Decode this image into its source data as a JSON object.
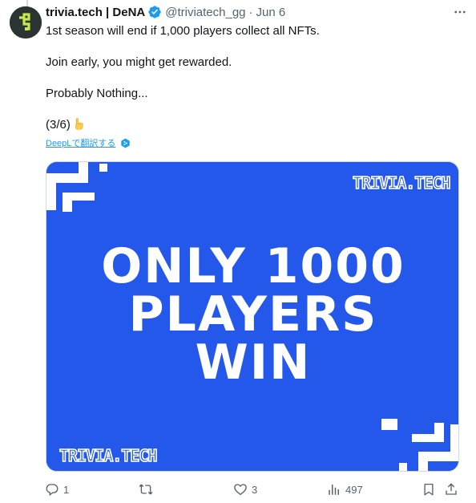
{
  "tweet": {
    "display_name": "trivia.tech | DeNA",
    "handle": "@triviatech_gg",
    "separator": "·",
    "date": "Jun 6",
    "lines": [
      "1st season will end if 1,000 players collect all NFTs.",
      "Join early, you might get rewarded.",
      "Probably Nothing...",
      "(3/6)"
    ],
    "translate_link": "DeepLで翻訳する"
  },
  "media": {
    "background_color": "#2358ea",
    "logo_text": "TRIVIA.TECH",
    "headline": [
      "ONLY 1000",
      "PLAYERS",
      "WIN"
    ]
  },
  "actions": {
    "replies": "1",
    "retweets": "",
    "likes": "3",
    "views": "497"
  },
  "icons": {
    "verified": "verified-badge-icon",
    "more": "more-options-icon",
    "emoji": "pointing-down-hand-emoji",
    "reply": "reply-icon",
    "retweet": "retweet-icon",
    "like": "heart-icon",
    "views": "views-chart-icon",
    "bookmark": "bookmark-icon",
    "share": "share-icon"
  },
  "colors": {
    "accent": "#1d9bf0",
    "text": "#0f1419",
    "muted": "#536471"
  }
}
